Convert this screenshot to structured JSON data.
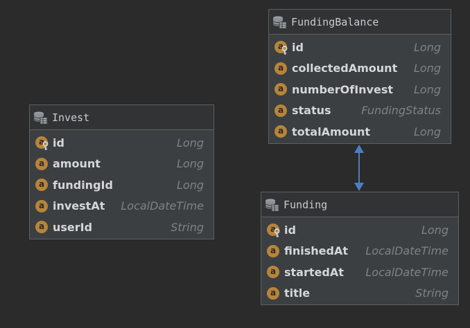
{
  "diagram": {
    "entities": [
      {
        "id": "invest",
        "name": "Invest",
        "fields": [
          {
            "name": "id",
            "type": "Long",
            "key": true
          },
          {
            "name": "amount",
            "type": "Long",
            "key": false
          },
          {
            "name": "fundingId",
            "type": "Long",
            "key": false
          },
          {
            "name": "investAt",
            "type": "LocalDateTime",
            "key": false
          },
          {
            "name": "userId",
            "type": "String",
            "key": false
          }
        ]
      },
      {
        "id": "fundingbalance",
        "name": "FundingBalance",
        "fields": [
          {
            "name": "id",
            "type": "Long",
            "key": true
          },
          {
            "name": "collectedAmount",
            "type": "Long",
            "key": false
          },
          {
            "name": "numberOfInvest",
            "type": "Long",
            "key": false
          },
          {
            "name": "status",
            "type": "FundingStatus",
            "key": false
          },
          {
            "name": "totalAmount",
            "type": "Long",
            "key": false
          }
        ]
      },
      {
        "id": "funding",
        "name": "Funding",
        "fields": [
          {
            "name": "id",
            "type": "Long",
            "key": true
          },
          {
            "name": "finishedAt",
            "type": "LocalDateTime",
            "key": false
          },
          {
            "name": "startedAt",
            "type": "LocalDateTime",
            "key": false
          },
          {
            "name": "title",
            "type": "String",
            "key": false
          }
        ]
      }
    ],
    "relations": [
      {
        "from": "fundingbalance",
        "to": "funding",
        "kind": "bidirectional-association"
      }
    ],
    "field_icon_letter": "a",
    "icons": {
      "entity": "database-table-icon",
      "field": "field-icon",
      "key": "primary-key-icon"
    },
    "colors": {
      "background": "#2b2b2b",
      "entity_body": "#3c3f41",
      "entity_header": "#313335",
      "border": "#5e6060",
      "field_icon": "#b8843a",
      "field_name": "#d4d6d8",
      "field_type": "#7f8284",
      "relation": "#4a7ec7"
    }
  }
}
